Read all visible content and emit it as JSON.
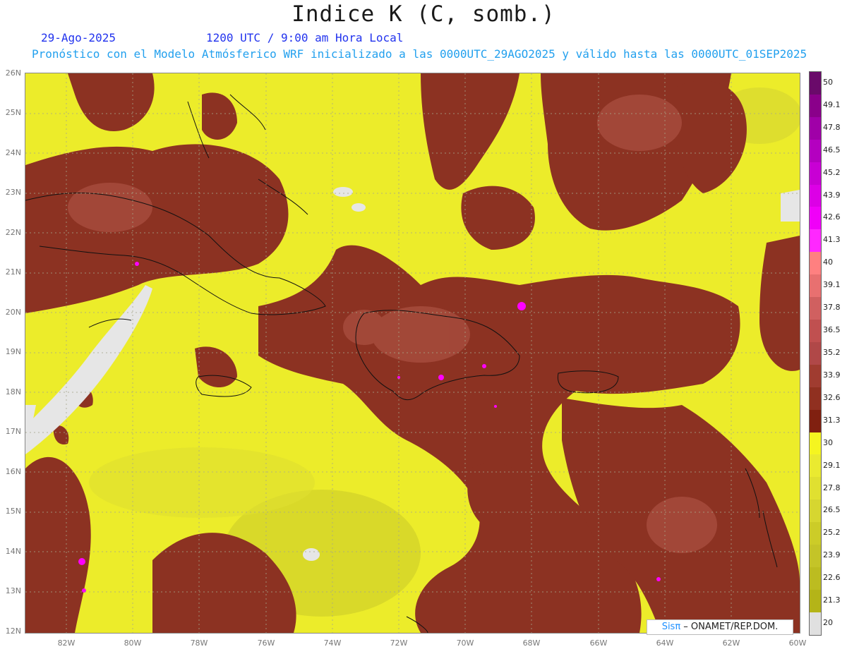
{
  "title": "Indice K (C, somb.)",
  "date": "29-Ago-2025",
  "time": "1200 UTC / 9:00 am Hora Local",
  "subtitle": "Pronóstico con el Modelo Atmósferico WRF inicializado a las 0000UTC_29AGO2025 y válido hasta las  0000UTC_01SEP2025",
  "lat_labels": [
    "26N",
    "25N",
    "24N",
    "23N",
    "22N",
    "21N",
    "20N",
    "19N",
    "18N",
    "17N",
    "16N",
    "15N",
    "14N",
    "13N",
    "12N"
  ],
  "lon_labels": [
    "82W",
    "80W",
    "78W",
    "76W",
    "74W",
    "72W",
    "70W",
    "68W",
    "66W",
    "64W",
    "62W",
    "60W"
  ],
  "map_extent": {
    "lon": [
      -83.3,
      -60
    ],
    "lat": [
      12,
      26.2
    ]
  },
  "colorbar": {
    "labels": [
      "50",
      "49.1",
      "47.8",
      "46.5",
      "45.2",
      "43.9",
      "42.6",
      "41.3",
      "40",
      "39.1",
      "37.8",
      "36.5",
      "35.2",
      "33.9",
      "32.6",
      "31.3",
      "30",
      "29.1",
      "27.8",
      "26.5",
      "25.2",
      "23.9",
      "22.6",
      "21.3",
      "20"
    ],
    "colors": [
      "#6a0a6a",
      "#8a008a",
      "#a000a8",
      "#b400c0",
      "#c800d4",
      "#dc00e6",
      "#f000f8",
      "#ff28ff",
      "#ff8080",
      "#e87070",
      "#d06060",
      "#c05050",
      "#b04848",
      "#a03c30",
      "#903020",
      "#802010",
      "#f5f520",
      "#eaea30",
      "#e0e030",
      "#d6d630",
      "#cccc28",
      "#c4c428",
      "#bcbc20",
      "#b4b418",
      "#e0e0e0"
    ]
  },
  "credit": {
    "sis": "Sisπ",
    "text": " – ONAMET/REP.DOM."
  },
  "colors": {
    "yellow": "#ecec2a",
    "brown": "#8c3222",
    "land_gray": "#e6e6e6",
    "magenta": "#ff00ff"
  }
}
